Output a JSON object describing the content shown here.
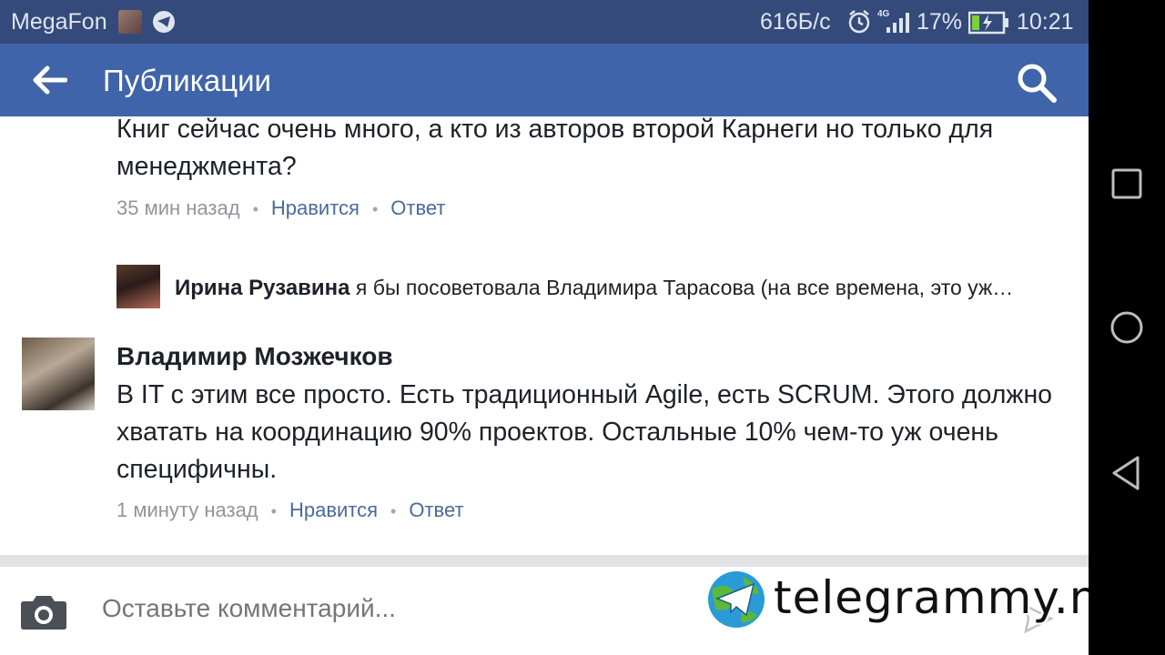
{
  "status_bar": {
    "carrier": "MegaFon",
    "network_speed": "616Б/с",
    "network_type": "4G",
    "battery_percent": "17%",
    "time": "10:21"
  },
  "app_bar": {
    "title": "Публикации",
    "back_icon": "arrow-left-icon",
    "search_icon": "search-icon"
  },
  "comments": [
    {
      "text": "Книг сейчас очень много, а кто из авторов второй Карнеги но только для менеджмента?",
      "time": "35 мин назад",
      "like": "Нравится",
      "reply": "Ответ",
      "reply_preview": {
        "author": "Ирина Рузавина",
        "text": "я бы посоветовала Владимира Тарасова (на все времена, это уж…"
      }
    },
    {
      "author": "Владимир Мозжечков",
      "text": "В IT с этим все просто. Есть традиционный Agile, есть SCRUM. Этого должно хватать на координацию 90% проектов. Остальные 10% чем-то уж очень специфичны.",
      "time": "1 минуту назад",
      "like": "Нравится",
      "reply": "Ответ"
    }
  ],
  "composer": {
    "placeholder": "Оставьте комментарий..."
  },
  "watermark": {
    "text": "telegrammy.net"
  },
  "colors": {
    "status_bar": "#344a7a",
    "app_bar": "#4064a9",
    "link": "#4b6a9b",
    "meta_text": "#90949c",
    "nav_bar": "#000000"
  }
}
